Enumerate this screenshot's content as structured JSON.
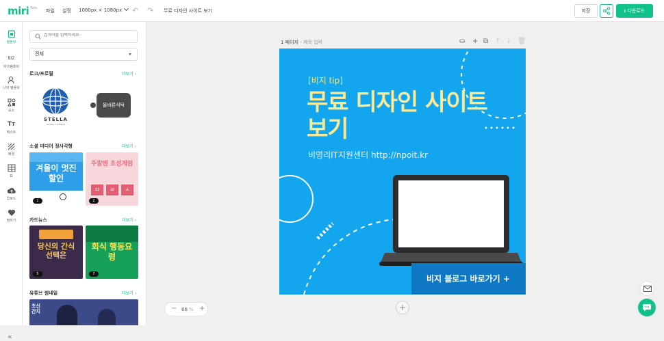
{
  "app": {
    "logo": "miri",
    "logo_badge": "Beta"
  },
  "topbar": {
    "menu_file": "파일",
    "menu_settings": "설정",
    "size": "1080px × 1080px",
    "doc_title": "무료 디자인 사이트 보기",
    "save_label": "저장",
    "download_label": "다운로드"
  },
  "rail": {
    "items": [
      {
        "label": "템플릿",
        "icon": "template-icon"
      },
      {
        "label": "비즈템플릿",
        "icon": "biz-icon",
        "glyph": "BIZ"
      },
      {
        "label": "나의 템플릿",
        "icon": "my-template-icon"
      },
      {
        "label": "요소",
        "icon": "elements-icon"
      },
      {
        "label": "텍스트",
        "icon": "text-icon",
        "glyph": "Tт"
      },
      {
        "label": "배경",
        "icon": "background-icon"
      },
      {
        "label": "표",
        "icon": "table-icon"
      },
      {
        "label": "업로드",
        "icon": "upload-icon"
      },
      {
        "label": "찜하기",
        "icon": "heart-icon"
      }
    ]
  },
  "panel": {
    "search_placeholder": "검색어를 입력하세요.",
    "filter_value": "전체",
    "more_label": "더보기",
    "sections": [
      {
        "title": "로고/프로필"
      },
      {
        "title": "소셜 미디어 정사각형"
      },
      {
        "title": "카드뉴스"
      },
      {
        "title": "유튜브 썸네일"
      }
    ],
    "logo_thumb_1": {
      "name": "STELLA",
      "sub": "GLOBAL COMPANY"
    },
    "logo_thumb_2": {
      "text": "올바른식탁"
    },
    "social_thumb_1": {
      "text": "겨울이 멋진 할인",
      "badge": "1"
    },
    "social_thumb_2": {
      "text": "주말엔 초성게임",
      "tiles": [
        "ㅁ",
        "ㄹ",
        "ㅅ"
      ],
      "badge": "2"
    },
    "card_thumb_1": {
      "text": "당신의 간식 선택은",
      "badge": "5"
    },
    "card_thumb_2": {
      "text": "회식 행동요령",
      "badge": "7"
    },
    "yt_thumb_1": {
      "text": "초신 간지"
    }
  },
  "canvas": {
    "page_label": "1 페이지",
    "title_placeholder": "- 제목 입력",
    "zoom": "66",
    "zoom_unit": "%"
  },
  "artwork": {
    "tag": "[비지 tip]",
    "headline_1": "무료 디자인 사이트",
    "headline_2": "보기",
    "subline": "비영리IT지원센터 http://npoit.kr",
    "cta": "비지 블로그 바로가기 +",
    "colors": {
      "background": "#13a6ef",
      "headline": "#fbe996",
      "cta": "#0e78c5"
    }
  },
  "colors": {
    "accent": "#12c08a"
  }
}
